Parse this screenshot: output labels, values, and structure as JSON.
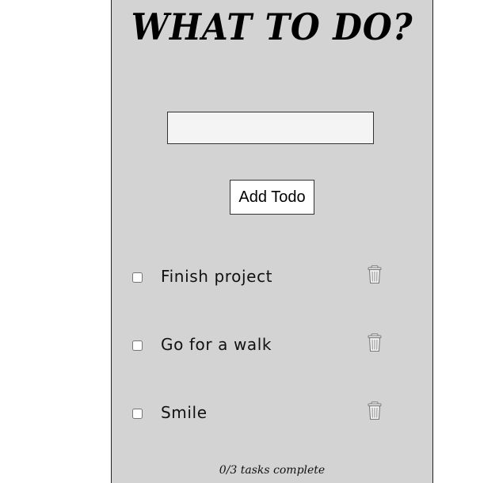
{
  "app": {
    "title": "WHAT TO DO?"
  },
  "form": {
    "input_value": "",
    "input_placeholder": "",
    "add_label": "Add Todo"
  },
  "todos": [
    {
      "text": "Finish project",
      "done": false
    },
    {
      "text": "Go for a walk",
      "done": false
    },
    {
      "text": "Smile",
      "done": false
    }
  ],
  "footer": {
    "status": "0/3 tasks complete"
  },
  "icons": {
    "delete": "trash-icon"
  },
  "colors": {
    "panel_bg": "#d3d3d3",
    "input_bg": "#f4f4f4",
    "trash": "#808080"
  }
}
